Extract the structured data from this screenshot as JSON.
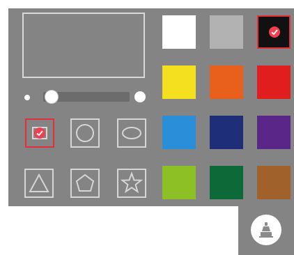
{
  "panel": {
    "background": "#848484",
    "slider": {
      "value": 0.1
    }
  },
  "shapes": [
    {
      "name": "square",
      "icon": "square-icon",
      "selected": true
    },
    {
      "name": "circle",
      "icon": "circle-icon",
      "selected": false
    },
    {
      "name": "ellipse",
      "icon": "ellipse-icon",
      "selected": false
    },
    {
      "name": "triangle",
      "icon": "triangle-icon",
      "selected": false
    },
    {
      "name": "pentagon",
      "icon": "pentagon-icon",
      "selected": false
    },
    {
      "name": "star",
      "icon": "star-icon",
      "selected": false
    }
  ],
  "colors": [
    {
      "name": "white",
      "hex": "#ffffff",
      "selected": false
    },
    {
      "name": "light-gray",
      "hex": "#b2b2b2",
      "selected": false
    },
    {
      "name": "black",
      "hex": "#111111",
      "selected": true
    },
    {
      "name": "yellow",
      "hex": "#f5e020",
      "selected": false
    },
    {
      "name": "orange",
      "hex": "#e8601c",
      "selected": false
    },
    {
      "name": "red",
      "hex": "#e01e1e",
      "selected": false
    },
    {
      "name": "blue",
      "hex": "#2a8ed8",
      "selected": false
    },
    {
      "name": "navy",
      "hex": "#1f2e78",
      "selected": false
    },
    {
      "name": "purple",
      "hex": "#5a2688",
      "selected": false
    },
    {
      "name": "lime",
      "hex": "#8cc024",
      "selected": false
    },
    {
      "name": "green",
      "hex": "#0d6a38",
      "selected": false
    },
    {
      "name": "brown",
      "hex": "#a0612a",
      "selected": false
    }
  ],
  "accent": "#e0303a",
  "fab": {
    "icon": "paint-fill-icon"
  }
}
